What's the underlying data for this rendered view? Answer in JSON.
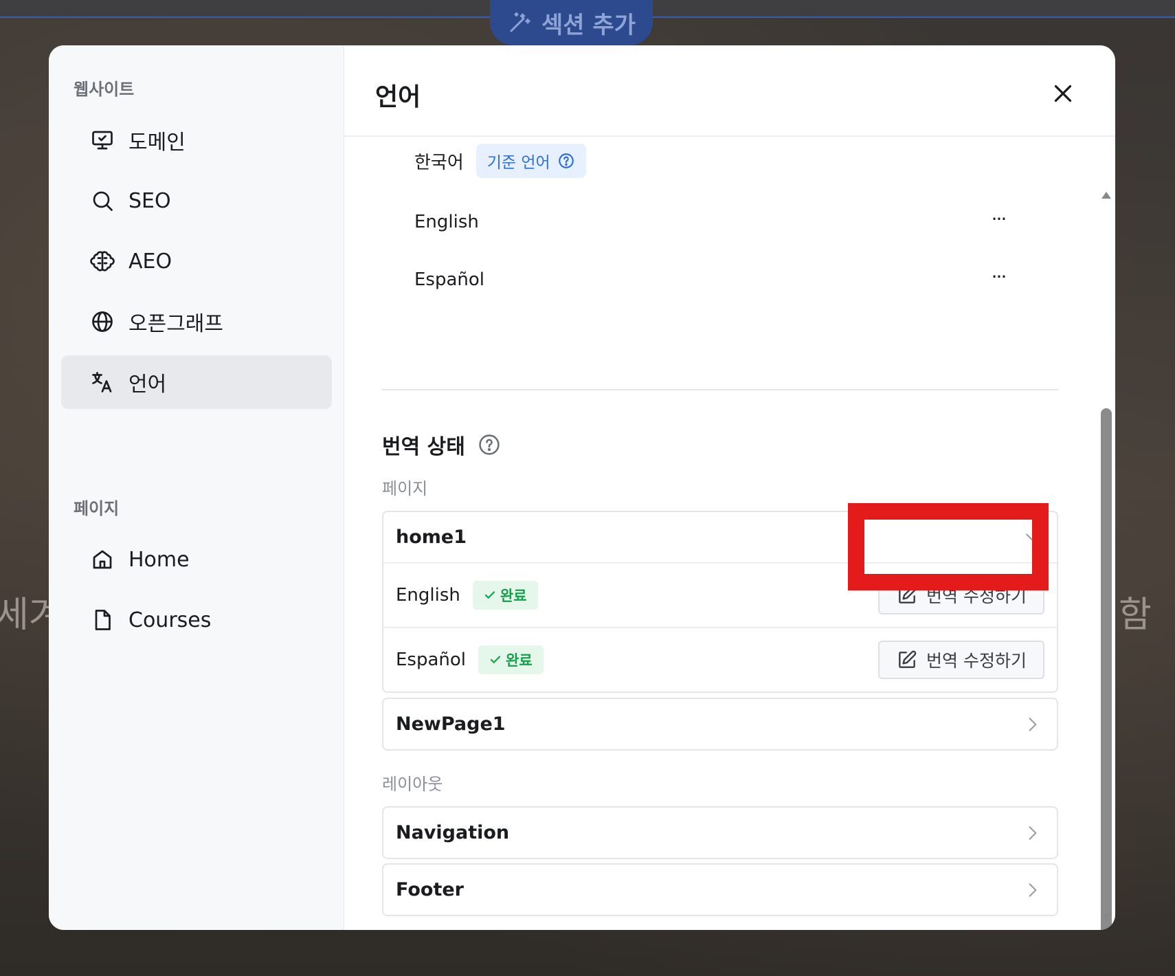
{
  "background": {
    "add_section_label": "섹션 추가",
    "left_text": "세겨",
    "right_text": "함"
  },
  "sidebar": {
    "website_title": "웹사이트",
    "website_items": [
      {
        "label": "도메인",
        "icon": "monitor-check-icon"
      },
      {
        "label": "SEO",
        "icon": "search-icon"
      },
      {
        "label": "AEO",
        "icon": "brain-icon"
      },
      {
        "label": "오픈그래프",
        "icon": "globe-icon"
      },
      {
        "label": "언어",
        "icon": "translate-icon",
        "active": true
      }
    ],
    "pages_title": "페이지",
    "page_items": [
      {
        "label": "Home",
        "icon": "home-icon"
      },
      {
        "label": "Courses",
        "icon": "file-icon"
      }
    ]
  },
  "main": {
    "title": "언어",
    "languages": [
      {
        "name": "한국어",
        "badge": "기준 언어"
      },
      {
        "name": "English",
        "more": "···"
      },
      {
        "name": "Español",
        "more": "···"
      }
    ],
    "translation_status_title": "번역 상태",
    "pages_label": "페이지",
    "layouts_label": "레이아웃",
    "page_cards": {
      "home1": {
        "name": "home1",
        "rows": [
          {
            "lang": "English",
            "status": "완료",
            "action": "번역 수정하기"
          },
          {
            "lang": "Español",
            "status": "완료",
            "action": "번역 수정하기"
          }
        ]
      },
      "newpage1": {
        "name": "NewPage1"
      }
    },
    "layout_cards": [
      {
        "name": "Navigation"
      },
      {
        "name": "Footer"
      }
    ]
  },
  "colors": {
    "highlight": "#e31b1b",
    "accent_blue": "#2f6fdb",
    "done_green": "#14a14a"
  }
}
